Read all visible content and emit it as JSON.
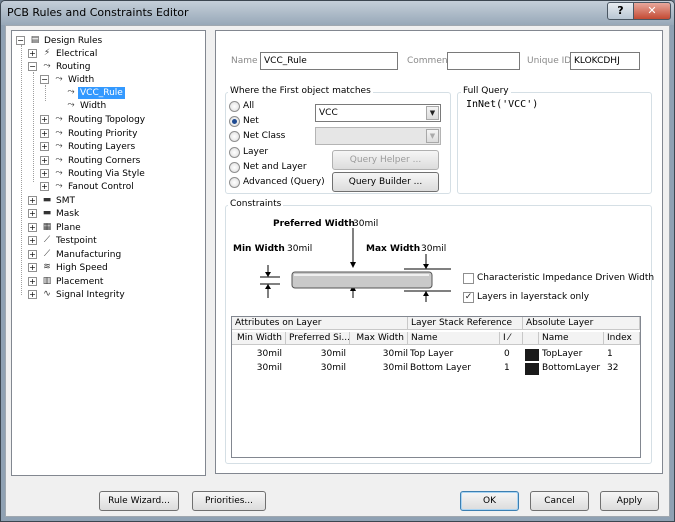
{
  "window": {
    "title": "PCB Rules and Constraints Editor",
    "help_glyph": "?",
    "close_glyph": "✕"
  },
  "tree": {
    "root": "Design Rules",
    "items": [
      {
        "label": "Electrical"
      },
      {
        "label": "Routing"
      },
      {
        "label": "Width"
      },
      {
        "label": "VCC_Rule"
      },
      {
        "label": "Width"
      },
      {
        "label": "Routing Topology"
      },
      {
        "label": "Routing Priority"
      },
      {
        "label": "Routing Layers"
      },
      {
        "label": "Routing Corners"
      },
      {
        "label": "Routing Via Style"
      },
      {
        "label": "Fanout Control"
      },
      {
        "label": "SMT"
      },
      {
        "label": "Mask"
      },
      {
        "label": "Plane"
      },
      {
        "label": "Testpoint"
      },
      {
        "label": "Manufacturing"
      },
      {
        "label": "High Speed"
      },
      {
        "label": "Placement"
      },
      {
        "label": "Signal Integrity"
      }
    ]
  },
  "header": {
    "name_label": "Name",
    "name_value": "VCC_Rule",
    "comment_label": "Comment",
    "comment_value": "",
    "uid_label": "Unique ID",
    "uid_value": "KLOKCDHJ"
  },
  "first_match": {
    "title": "Where the First object matches",
    "options": [
      "All",
      "Net",
      "Net Class",
      "Layer",
      "Net and Layer",
      "Advanced (Query)"
    ],
    "selected": "Net",
    "net_value": "VCC",
    "query_helper": "Query Helper ...",
    "query_builder": "Query Builder ..."
  },
  "full_query": {
    "title": "Full Query",
    "text": "InNet('VCC')"
  },
  "constraints": {
    "title": "Constraints",
    "preferred_label": "Preferred Width",
    "preferred_value": "30mil",
    "min_label": "Min Width",
    "min_value": "30mil",
    "max_label": "Max Width",
    "max_value": "30mil",
    "impedance_label": "Characteristic Impedance Driven Width",
    "impedance_checked": false,
    "layerstack_label": "Layers in layerstack only",
    "layerstack_checked": true,
    "check_glyph": "✓"
  },
  "table": {
    "groups": [
      "Attributes on Layer",
      "Layer Stack Reference",
      "Absolute Layer"
    ],
    "columns": [
      "Min Width",
      "Preferred Si...",
      "Max Width",
      "Name",
      "I ⁄",
      "",
      "Name",
      "Index"
    ],
    "rows": [
      {
        "min": "30mil",
        "pref": "30mil",
        "max": "30mil",
        "name": "Top Layer",
        "i": "0",
        "abs_name": "TopLayer",
        "index": "1",
        "color": "#1a1a1a"
      },
      {
        "min": "30mil",
        "pref": "30mil",
        "max": "30mil",
        "name": "Bottom Layer",
        "i": "1",
        "abs_name": "BottomLayer",
        "index": "32",
        "color": "#1a1a1a"
      }
    ]
  },
  "buttons": {
    "rule_wizard": "Rule Wizard...",
    "priorities": "Priorities...",
    "ok": "OK",
    "cancel": "Cancel",
    "apply": "Apply"
  }
}
